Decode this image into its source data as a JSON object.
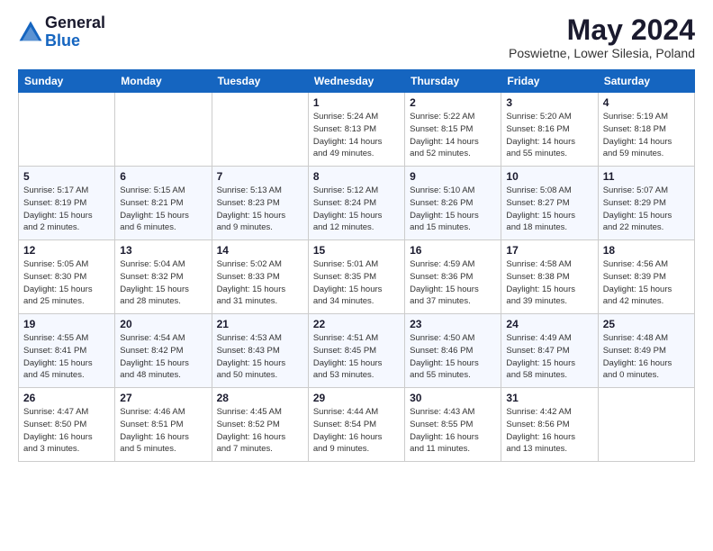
{
  "header": {
    "logo_general": "General",
    "logo_blue": "Blue",
    "month_title": "May 2024",
    "location": "Poswietne, Lower Silesia, Poland"
  },
  "days_of_week": [
    "Sunday",
    "Monday",
    "Tuesday",
    "Wednesday",
    "Thursday",
    "Friday",
    "Saturday"
  ],
  "weeks": [
    [
      {
        "day": "",
        "info": ""
      },
      {
        "day": "",
        "info": ""
      },
      {
        "day": "",
        "info": ""
      },
      {
        "day": "1",
        "info": "Sunrise: 5:24 AM\nSunset: 8:13 PM\nDaylight: 14 hours\nand 49 minutes."
      },
      {
        "day": "2",
        "info": "Sunrise: 5:22 AM\nSunset: 8:15 PM\nDaylight: 14 hours\nand 52 minutes."
      },
      {
        "day": "3",
        "info": "Sunrise: 5:20 AM\nSunset: 8:16 PM\nDaylight: 14 hours\nand 55 minutes."
      },
      {
        "day": "4",
        "info": "Sunrise: 5:19 AM\nSunset: 8:18 PM\nDaylight: 14 hours\nand 59 minutes."
      }
    ],
    [
      {
        "day": "5",
        "info": "Sunrise: 5:17 AM\nSunset: 8:19 PM\nDaylight: 15 hours\nand 2 minutes."
      },
      {
        "day": "6",
        "info": "Sunrise: 5:15 AM\nSunset: 8:21 PM\nDaylight: 15 hours\nand 6 minutes."
      },
      {
        "day": "7",
        "info": "Sunrise: 5:13 AM\nSunset: 8:23 PM\nDaylight: 15 hours\nand 9 minutes."
      },
      {
        "day": "8",
        "info": "Sunrise: 5:12 AM\nSunset: 8:24 PM\nDaylight: 15 hours\nand 12 minutes."
      },
      {
        "day": "9",
        "info": "Sunrise: 5:10 AM\nSunset: 8:26 PM\nDaylight: 15 hours\nand 15 minutes."
      },
      {
        "day": "10",
        "info": "Sunrise: 5:08 AM\nSunset: 8:27 PM\nDaylight: 15 hours\nand 18 minutes."
      },
      {
        "day": "11",
        "info": "Sunrise: 5:07 AM\nSunset: 8:29 PM\nDaylight: 15 hours\nand 22 minutes."
      }
    ],
    [
      {
        "day": "12",
        "info": "Sunrise: 5:05 AM\nSunset: 8:30 PM\nDaylight: 15 hours\nand 25 minutes."
      },
      {
        "day": "13",
        "info": "Sunrise: 5:04 AM\nSunset: 8:32 PM\nDaylight: 15 hours\nand 28 minutes."
      },
      {
        "day": "14",
        "info": "Sunrise: 5:02 AM\nSunset: 8:33 PM\nDaylight: 15 hours\nand 31 minutes."
      },
      {
        "day": "15",
        "info": "Sunrise: 5:01 AM\nSunset: 8:35 PM\nDaylight: 15 hours\nand 34 minutes."
      },
      {
        "day": "16",
        "info": "Sunrise: 4:59 AM\nSunset: 8:36 PM\nDaylight: 15 hours\nand 37 minutes."
      },
      {
        "day": "17",
        "info": "Sunrise: 4:58 AM\nSunset: 8:38 PM\nDaylight: 15 hours\nand 39 minutes."
      },
      {
        "day": "18",
        "info": "Sunrise: 4:56 AM\nSunset: 8:39 PM\nDaylight: 15 hours\nand 42 minutes."
      }
    ],
    [
      {
        "day": "19",
        "info": "Sunrise: 4:55 AM\nSunset: 8:41 PM\nDaylight: 15 hours\nand 45 minutes."
      },
      {
        "day": "20",
        "info": "Sunrise: 4:54 AM\nSunset: 8:42 PM\nDaylight: 15 hours\nand 48 minutes."
      },
      {
        "day": "21",
        "info": "Sunrise: 4:53 AM\nSunset: 8:43 PM\nDaylight: 15 hours\nand 50 minutes."
      },
      {
        "day": "22",
        "info": "Sunrise: 4:51 AM\nSunset: 8:45 PM\nDaylight: 15 hours\nand 53 minutes."
      },
      {
        "day": "23",
        "info": "Sunrise: 4:50 AM\nSunset: 8:46 PM\nDaylight: 15 hours\nand 55 minutes."
      },
      {
        "day": "24",
        "info": "Sunrise: 4:49 AM\nSunset: 8:47 PM\nDaylight: 15 hours\nand 58 minutes."
      },
      {
        "day": "25",
        "info": "Sunrise: 4:48 AM\nSunset: 8:49 PM\nDaylight: 16 hours\nand 0 minutes."
      }
    ],
    [
      {
        "day": "26",
        "info": "Sunrise: 4:47 AM\nSunset: 8:50 PM\nDaylight: 16 hours\nand 3 minutes."
      },
      {
        "day": "27",
        "info": "Sunrise: 4:46 AM\nSunset: 8:51 PM\nDaylight: 16 hours\nand 5 minutes."
      },
      {
        "day": "28",
        "info": "Sunrise: 4:45 AM\nSunset: 8:52 PM\nDaylight: 16 hours\nand 7 minutes."
      },
      {
        "day": "29",
        "info": "Sunrise: 4:44 AM\nSunset: 8:54 PM\nDaylight: 16 hours\nand 9 minutes."
      },
      {
        "day": "30",
        "info": "Sunrise: 4:43 AM\nSunset: 8:55 PM\nDaylight: 16 hours\nand 11 minutes."
      },
      {
        "day": "31",
        "info": "Sunrise: 4:42 AM\nSunset: 8:56 PM\nDaylight: 16 hours\nand 13 minutes."
      },
      {
        "day": "",
        "info": ""
      }
    ]
  ]
}
